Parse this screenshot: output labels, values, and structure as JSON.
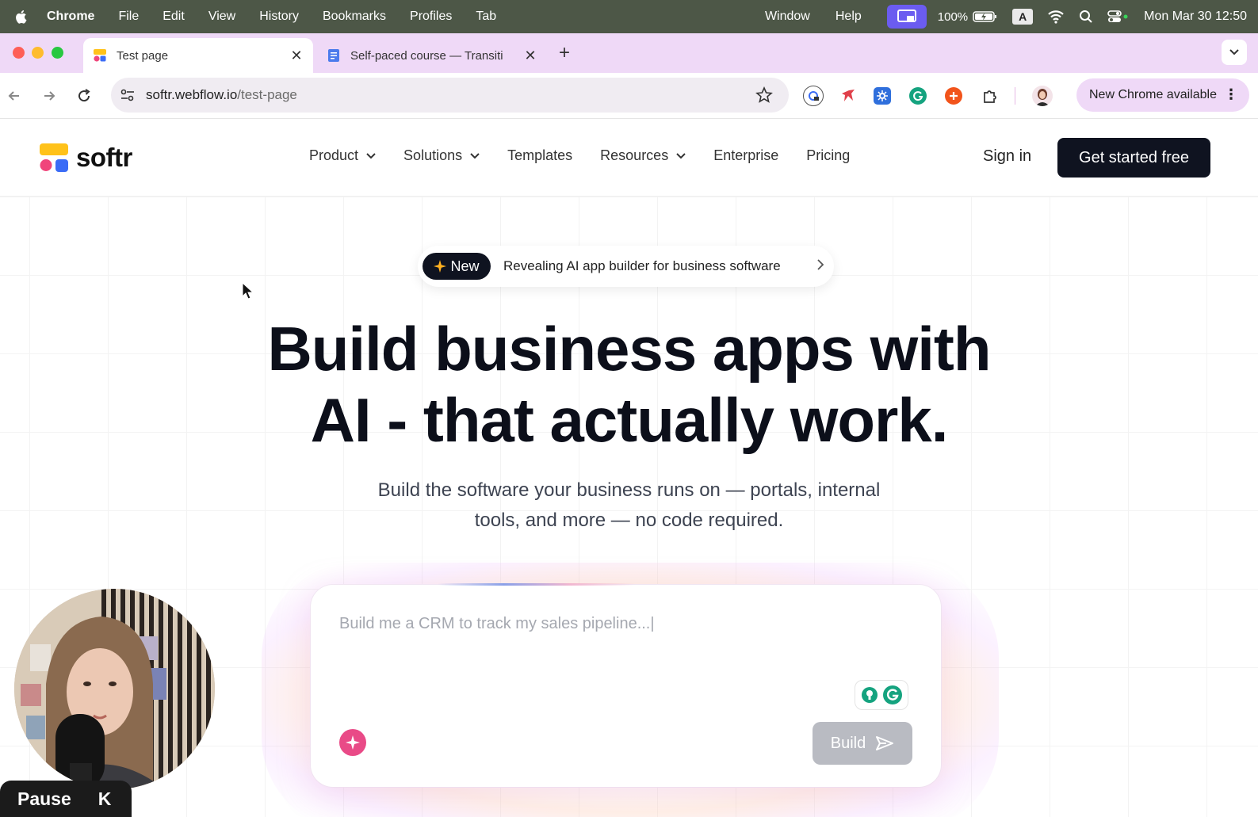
{
  "menubar": {
    "app": "Chrome",
    "items": [
      "File",
      "Edit",
      "View",
      "History",
      "Bookmarks",
      "Profiles",
      "Tab"
    ],
    "right_items": [
      "Window",
      "Help"
    ],
    "battery": "100%",
    "input_source": "A",
    "clock": "Mon Mar 30  12:50"
  },
  "tabs": [
    {
      "title": "Test page"
    },
    {
      "title": "Self-paced course — Transiti"
    }
  ],
  "toolbar": {
    "url_host": "softr.webflow.io",
    "url_path": "/test-page",
    "new_chrome": "New Chrome available"
  },
  "site": {
    "logo": "softr",
    "nav": [
      "Product",
      "Solutions",
      "Templates",
      "Resources",
      "Enterprise",
      "Pricing"
    ],
    "sign_in": "Sign in",
    "cta": "Get started free",
    "badge_label": "New",
    "badge_text": "Revealing AI app builder for business software",
    "hero_line1": "Build business apps with",
    "hero_line2": "AI - that actually work.",
    "sub_line1": "Build the software your business runs on — portals, internal",
    "sub_line2": "tools, and more — no code required.",
    "prompt_placeholder": "Build me a CRM to track my sales pipeline...|",
    "build_button": "Build"
  },
  "recorder": {
    "pause_label": "Pause",
    "pause_key": "K"
  },
  "colors": {
    "menubar": "#4d5747",
    "tabstrip": "#efd9f7",
    "cta": "#0f1320",
    "sparkle": "#e94a87"
  }
}
